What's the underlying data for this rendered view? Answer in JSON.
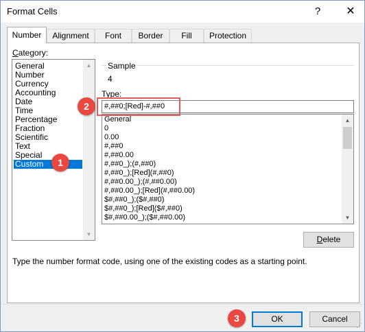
{
  "window": {
    "title": "Format Cells",
    "help_glyph": "?",
    "close_glyph": "✕"
  },
  "tabs": [
    {
      "label": "Number",
      "active": true
    },
    {
      "label": "Alignment",
      "active": false
    },
    {
      "label": "Font",
      "active": false
    },
    {
      "label": "Border",
      "active": false
    },
    {
      "label": "Fill",
      "active": false
    },
    {
      "label": "Protection",
      "active": false
    }
  ],
  "category": {
    "label": "Category:",
    "items": [
      "General",
      "Number",
      "Currency",
      "Accounting",
      "Date",
      "Time",
      "Percentage",
      "Fraction",
      "Scientific",
      "Text",
      "Special",
      "Custom"
    ],
    "selected": "Custom"
  },
  "sample": {
    "label": "Sample",
    "value": "4"
  },
  "type": {
    "label": "Type:",
    "value": "#,##0;[Red]-#,##0"
  },
  "formats": [
    "General",
    "0",
    "0.00",
    "#,##0",
    "#,##0.00",
    "#,##0_);(#,##0)",
    "#,##0_);[Red](#,##0)",
    "#,##0.00_);(#,##0.00)",
    "#,##0.00_);[Red](#,##0.00)",
    "$#,##0_);($#,##0)",
    "$#,##0_);[Red]($#,##0)",
    "$#,##0.00_);($#,##0.00)"
  ],
  "buttons": {
    "delete": "Delete",
    "ok": "OK",
    "cancel": "Cancel"
  },
  "hint": "Type the number format code, using one of the existing codes as a starting point.",
  "annotations": [
    "1",
    "2",
    "3"
  ],
  "colors": {
    "selection": "#0078d7",
    "annotation": "#e8483f",
    "highlight_border": "#e15b5b"
  },
  "icons": {
    "scroll_up": "▲",
    "scroll_down": "▼"
  }
}
